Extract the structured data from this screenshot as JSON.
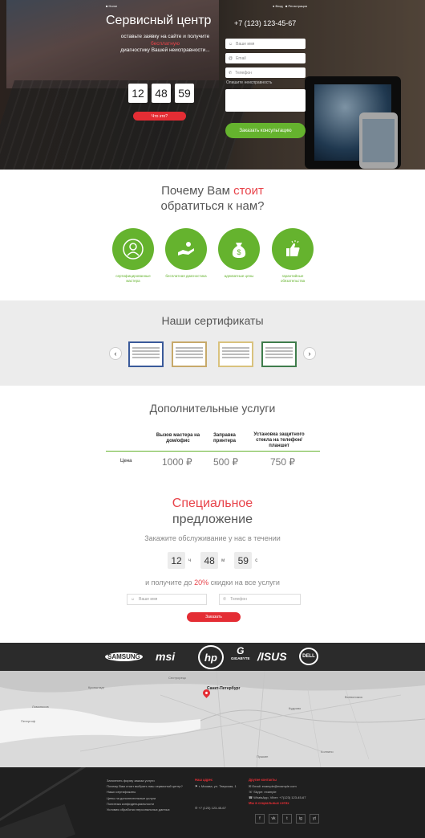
{
  "hero": {
    "nav_home": "Home",
    "nav_login": "Вход",
    "nav_register": "Регистрация",
    "title": "Сервисный центр",
    "text_line1": "оставьте заявку на сайте и получите",
    "text_accent": "бесплатную",
    "text_line2": "диагностику Вашей неисправности...",
    "timer": [
      "12",
      "48",
      "59"
    ],
    "what_button": "Что это?",
    "phone": "+7 (123) 123-45-67",
    "form": {
      "name_placeholder": "Ваше имя",
      "email_placeholder": "Email",
      "phone_placeholder": "Телефон",
      "problem_label": "Опишите неисправность",
      "submit": "Заказать консультацию"
    }
  },
  "why": {
    "title_part1": "Почему Вам ",
    "title_accent": "стоит",
    "title_part2": "обратиться к нам?",
    "features": [
      {
        "icon": "user-icon",
        "label": "сертифицированные мастера"
      },
      {
        "icon": "hand-money-icon",
        "label": "бесплатная диагностика"
      },
      {
        "icon": "money-bag-icon",
        "label": "адекватные цены"
      },
      {
        "icon": "thumbs-up-icon",
        "label": "гарантийные обязательства"
      }
    ]
  },
  "certificates": {
    "title": "Наши сертификаты"
  },
  "services": {
    "title": "Дополнительные услуги",
    "headers": [
      "Вызов мастера на дом/офис",
      "Заправка принтера",
      "Установка защитного стекла на телефон/планшет"
    ],
    "row_label": "Цена",
    "prices": [
      "1000 ₽",
      "500 ₽",
      "750 ₽"
    ]
  },
  "special": {
    "title_accent": "Специальное",
    "title_rest": "предложение",
    "subtitle": "Закажите обслуживание у нас в течении",
    "timer": [
      {
        "value": "12",
        "unit": "ч"
      },
      {
        "value": "48",
        "unit": "м"
      },
      {
        "value": "59",
        "unit": "с"
      }
    ],
    "discount_part1": "и получите до ",
    "discount_accent": "20%",
    "discount_part2": " скидки на все услуги",
    "name_placeholder": "Ваше имя",
    "phone_placeholder": "Телефон",
    "submit": "Заказать"
  },
  "brands": {
    "samsung": "SAMSUNG",
    "msi": "msi",
    "hp": "hp",
    "gigabyte": "G",
    "gigabyte_sub": "GIGABYTE",
    "asus": "/ISUS",
    "dell": "DELL"
  },
  "map": {
    "city": "Санкт-Петербург",
    "labels": [
      "Петергоф",
      "Ломоносов",
      "Кронштадт",
      "Сестрорецк",
      "Колпино",
      "Пушкин",
      "Всеволожск",
      "Кудрово"
    ]
  },
  "footer": {
    "links": [
      "Заполнить форму заказа услуги",
      "Почему Вам стоит выбрать наш сервисный центр?",
      "Наши сертификаты",
      "Цены на дополнительные услуги",
      "Политика конфиденциальности",
      "Условия обработки персональных данных"
    ],
    "address_head": "Наш адрес",
    "address": "г. Москва, ул. Тверская, 1",
    "phone": "+7 (123) 123-45-67",
    "contacts_head": "Другие контакты",
    "contacts": [
      "Email: example@example.com",
      "Skype: example",
      "WhatsApp, Viber: +7(123) 123-45-67"
    ],
    "social_head": "Мы в социальных сетях",
    "socials": [
      "f",
      "vk",
      "t",
      "ig",
      "yt"
    ]
  }
}
